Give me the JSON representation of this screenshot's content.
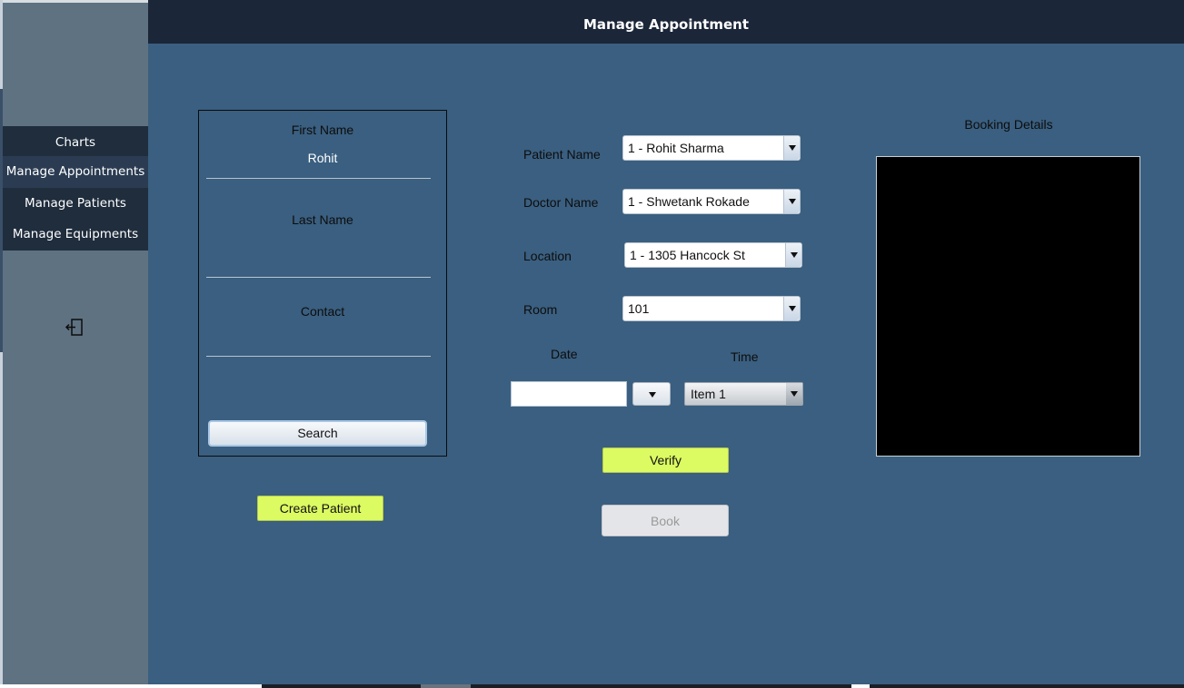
{
  "window": {
    "title": "Manage Appointment"
  },
  "sidebar": {
    "items": [
      {
        "label": "Charts"
      },
      {
        "label": "Manage Appointments"
      },
      {
        "label": "Manage Patients"
      },
      {
        "label": "Manage Equipments"
      }
    ],
    "logout_icon": "logout-icon"
  },
  "patient_form": {
    "first_name_label": "First Name",
    "first_name_value": "Rohit",
    "last_name_label": "Last Name",
    "last_name_value": "",
    "contact_label": "Contact",
    "contact_value": "",
    "search_label": "Search"
  },
  "create_patient_label": "Create Patient",
  "booking_form": {
    "patient_name_label": "Patient Name",
    "patient_name_value": "1 - Rohit Sharma",
    "doctor_name_label": "Doctor Name",
    "doctor_name_value": "1 - Shwetank Rokade",
    "location_label": "Location",
    "location_value": "1 - 1305 Hancock St",
    "room_label": "Room",
    "room_value": "101",
    "date_label": "Date",
    "date_value": "",
    "time_label": "Time",
    "time_value": "Item 1",
    "verify_label": "Verify",
    "book_label": "Book"
  },
  "booking_details": {
    "title": "Booking Details"
  },
  "colors": {
    "background": "#3a5f80",
    "header": "#1b2638",
    "sidebar": "#5e7282",
    "menu": "#1f2d3d",
    "accent_button": "#dcfa62",
    "details_box": "#000000"
  }
}
